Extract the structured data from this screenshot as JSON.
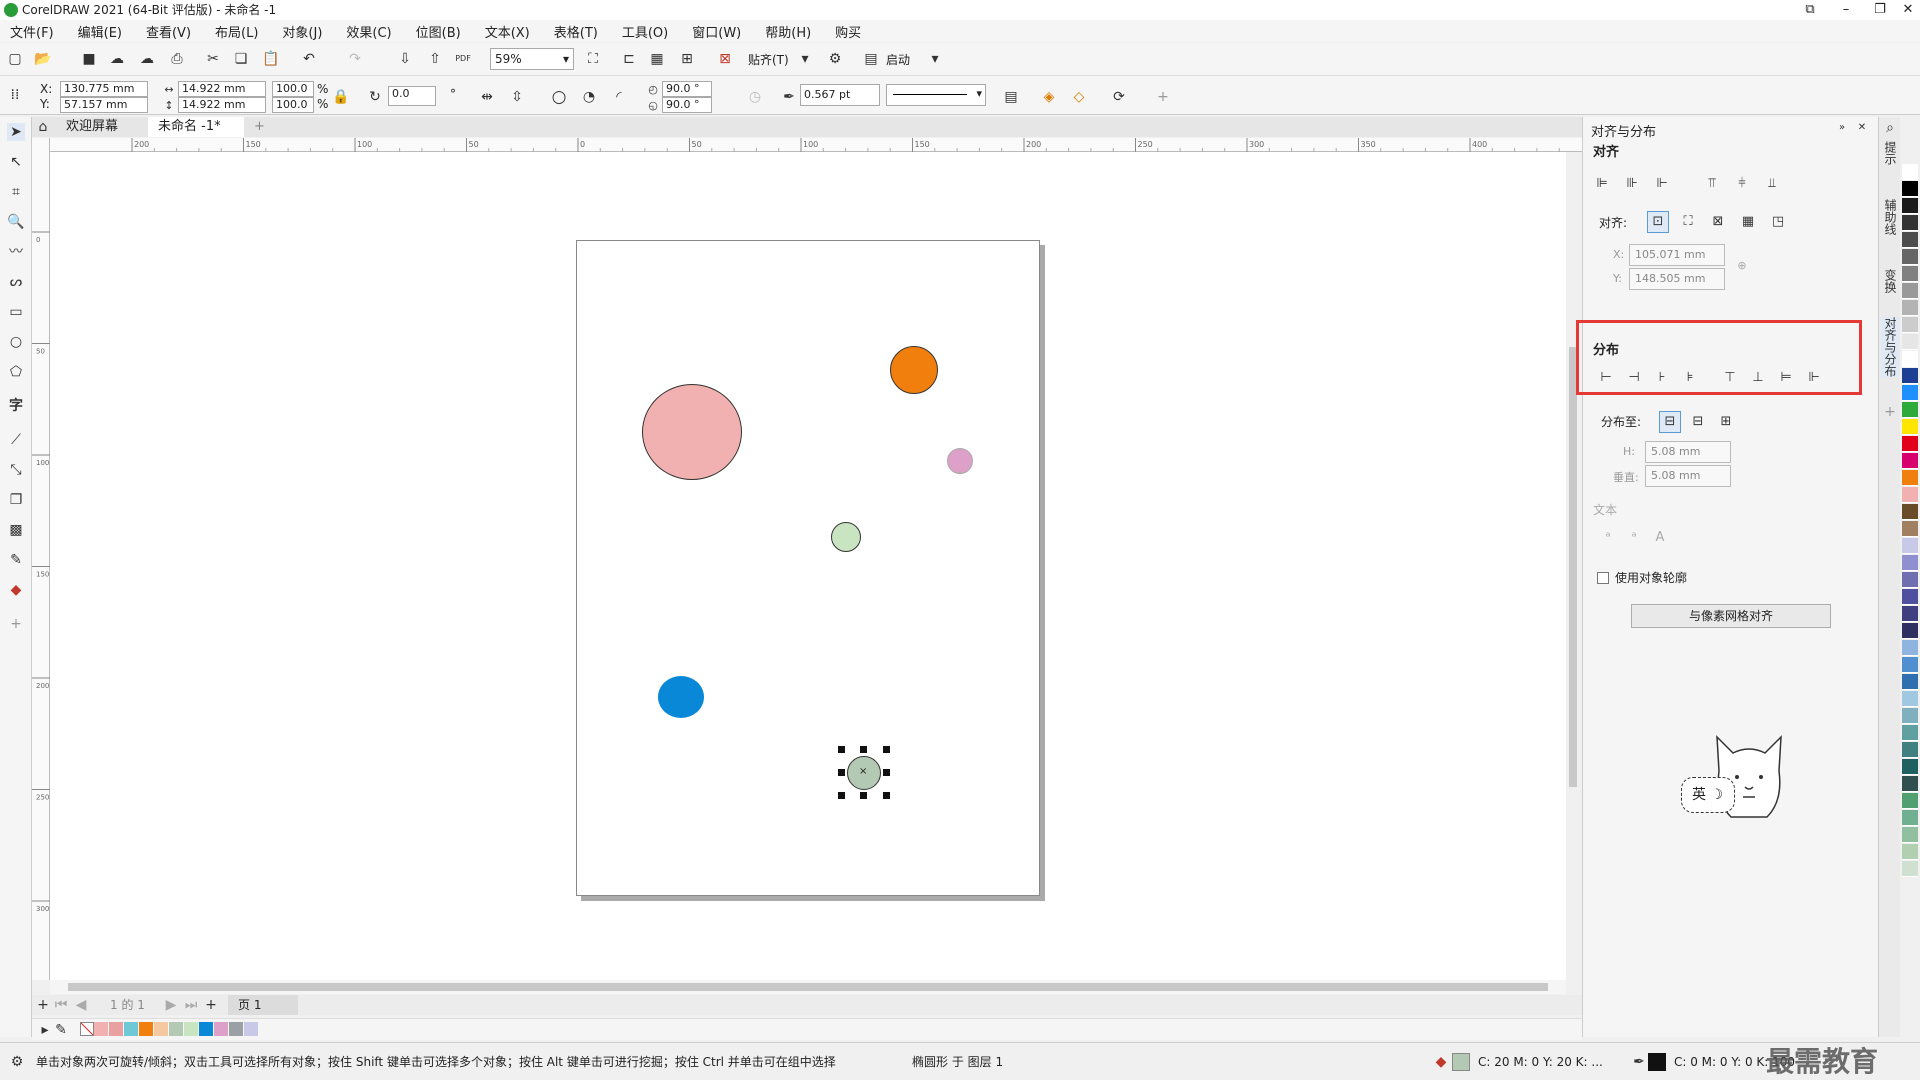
{
  "window": {
    "title": "CorelDRAW 2021 (64-Bit 评估版) - 未命名 -1",
    "min": "–",
    "max": "❐",
    "close": "✕",
    "restore": "⧉"
  },
  "menu": [
    "文件(F)",
    "编辑(E)",
    "查看(V)",
    "布局(L)",
    "对象(J)",
    "效果(C)",
    "位图(B)",
    "文本(X)",
    "表格(T)",
    "工具(O)",
    "窗口(W)",
    "帮助(H)",
    "购买"
  ],
  "toolbar": {
    "zoom": "59%",
    "snap": "贴齐(T)",
    "launch": "启动",
    "pdf": "PDF"
  },
  "props": {
    "x_label": "X:",
    "y_label": "Y:",
    "x": "130.775 mm",
    "y": "57.157 mm",
    "w": "14.922 mm",
    "h": "14.922 mm",
    "sx": "100.0",
    "sy": "100.0",
    "pct": "%",
    "angle": "0.0",
    "deg": "°",
    "start_angle": "90.0 °",
    "end_angle": "90.0 °",
    "outline": "0.567 pt"
  },
  "tabs": {
    "welcome": "欢迎屏幕",
    "doc": "未命名 -1*",
    "add": "+"
  },
  "ruler": {
    "ticks": [
      "200",
      "150",
      "100",
      "50",
      "0",
      "50",
      "100",
      "150",
      "200",
      "250",
      "300",
      "350",
      "400"
    ]
  },
  "vruler": [
    "0",
    "50",
    "100",
    "150",
    "200",
    "250",
    "300"
  ],
  "canvas_circles": [
    {
      "name": "pink-circle",
      "color": "#f2b1b1"
    },
    {
      "name": "orange-circle",
      "color": "#f07f0e"
    },
    {
      "name": "lavender-circle",
      "color": "#dda0c8"
    },
    {
      "name": "green-circle",
      "color": "#c8e4c0"
    },
    {
      "name": "blue-circle",
      "color": "#0a88d8"
    },
    {
      "name": "selected-gray-circle",
      "color": "#b3c9b3"
    }
  ],
  "dock": {
    "title": "对齐与分布",
    "align_title": "对齐",
    "align_to": "对齐:",
    "x_label": "X:",
    "x_value": "105.071 mm",
    "y_label": "Y:",
    "y_value": "148.505 mm",
    "distribute_title": "分布",
    "distribute_to": "分布至:",
    "h_label": "H:",
    "h_value": "5.08 mm",
    "v_label": "垂直:",
    "v_value": "5.08 mm",
    "text_title": "文本",
    "use_outline": "使用对象轮廓",
    "pixel_grid_btn": "与像素网格对齐",
    "ime_text": "英"
  },
  "vtabs": [
    "提示",
    "辅助线",
    "变换",
    "对齐与分布"
  ],
  "palette": [
    "#ffffff",
    "#000000",
    "#1a1a1a",
    "#333333",
    "#4d4d4d",
    "#666666",
    "#808080",
    "#999999",
    "#b3b3b3",
    "#cccccc",
    "#e6e6e6",
    "#ffffff",
    "#1c3f94",
    "#1e90ff",
    "#2eaa3c",
    "#ffe600",
    "#e3001b",
    "#d6006f",
    "#f07f0e",
    "#f2b1b1",
    "#6b4c2a",
    "#a08060",
    "#c8c8e8",
    "#9090d0",
    "#7070b0",
    "#5050a0",
    "#404080",
    "#303060",
    "#8fb4e0",
    "#5090d0",
    "#3070b0",
    "#a0c8e0",
    "#80b0c0",
    "#60a0a0",
    "#408080",
    "#206060",
    "#305050",
    "#50a070",
    "#70b090",
    "#90c0a0",
    "#b0d0b0",
    "#d0e0d0"
  ],
  "pagebar": {
    "counter": "1 的 1",
    "page": "页 1"
  },
  "docpal": [
    "#f2b1b1",
    "#e8a0a0",
    "#6ec8d6",
    "#f07f0e",
    "#f6c8a0",
    "#b3c9b3",
    "#c8e4c0",
    "#0a88d8",
    "#dda0c8",
    "#9aa0a6",
    "#c8c8e8"
  ],
  "status": {
    "hint": "单击对象两次可旋转/倾斜；双击工具可选择所有对象；按住 Shift 键单击可选择多个对象；按住 Alt 键单击可进行挖掘；按住 Ctrl 并单击可在组中选择",
    "obj": "椭圆形 于 图层 1",
    "fill_cmyk": "C: 20 M: 0 Y: 20 K: ...",
    "outline_cmyk": "C: 0 M: 0 Y: 0 K: 100",
    "watermark": "最需教育"
  }
}
